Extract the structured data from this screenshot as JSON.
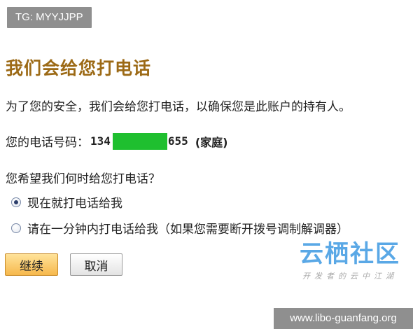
{
  "watermarks": {
    "tg_label": "TG: MYYJJPP",
    "logo_main": "云栖社区",
    "logo_sub": "开发者的云中江湖",
    "site_url": "www.libo-guanfang.org"
  },
  "page": {
    "title": "我们会给您打电话",
    "intro": "为了您的安全，我们会给您打电话，以确保您是此账户的持有人。",
    "phone": {
      "label": "您的电话号码：",
      "prefix": "134",
      "suffix": "655",
      "type": "(家庭)"
    },
    "question": "您希望我们何时给您打电话？",
    "options": [
      {
        "label": "现在就打电话给我",
        "checked": true
      },
      {
        "label": "请在一分钟内打电话给我（如果您需要断开拨号调制解调器）",
        "checked": false
      }
    ]
  },
  "buttons": {
    "continue_label": "继续",
    "cancel_label": "取消"
  },
  "colors": {
    "title": "#9c6a16",
    "redaction": "#1fbf2f",
    "continue_button": "#f6b84c",
    "logo": "#5aa8e6"
  }
}
